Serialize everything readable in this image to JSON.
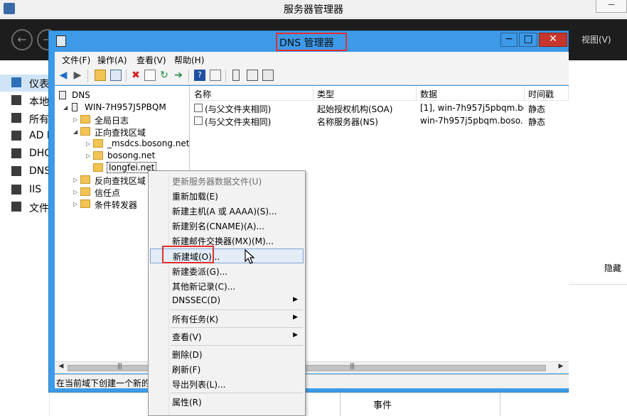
{
  "server_manager": {
    "title": "服务器管理器",
    "view_menu": "视图(V)",
    "sidebar": [
      {
        "label": "仪表",
        "icon": "dashboard-icon"
      },
      {
        "label": "本地",
        "icon": "local-server-icon"
      },
      {
        "label": "所有",
        "icon": "all-servers-icon"
      },
      {
        "label": "AD I",
        "icon": "ad-icon"
      },
      {
        "label": "DHC",
        "icon": "dhcp-icon"
      },
      {
        "label": "DNS",
        "icon": "dns-icon"
      },
      {
        "label": "IIS",
        "icon": "iis-icon"
      },
      {
        "label": "文件",
        "icon": "file-services-icon"
      }
    ],
    "hide_label": "隐藏",
    "events_label": "事件"
  },
  "dns_window": {
    "title": "DNS 管理器",
    "menus": [
      "文件(F)",
      "操作(A)",
      "查看(V)",
      "帮助(H)"
    ],
    "tree": {
      "root": "DNS",
      "server": "WIN-7H957J5PBQM",
      "global_logs": "全局日志",
      "forward_zones": "正向查找区域",
      "msdcs": "_msdcs.bosong.net",
      "bosong": "bosong.net",
      "longfei": "longfei.net",
      "reverse_zones": "反向查找区域",
      "trust_points": "信任点",
      "conditional_forwarders": "条件转发器"
    },
    "columns": [
      "名称",
      "类型",
      "数据",
      "时间戳"
    ],
    "records": [
      {
        "name": "(与父文件夹相同)",
        "type": "起始授权机构(SOA)",
        "data": "[1], win-7h957j5pbqm.bo...",
        "timestamp": "静态"
      },
      {
        "name": "(与父文件夹相同)",
        "type": "名称服务器(NS)",
        "data": "win-7h957j5pbqm.boso...",
        "timestamp": "静态"
      }
    ],
    "status": "在当前域下创建一个新的"
  },
  "context_menu": {
    "items": [
      {
        "label": "更新服务器数据文件(U)",
        "disabled": true
      },
      {
        "label": "重新加载(E)"
      },
      {
        "label": "新建主机(A 或 AAAA)(S)..."
      },
      {
        "label": "新建别名(CNAME)(A)..."
      },
      {
        "label": "新建邮件交换器(MX)(M)..."
      },
      {
        "label": "新建域(O)...",
        "highlighted": true
      },
      {
        "label": "新建委派(G)..."
      },
      {
        "label": "其他新记录(C)..."
      },
      {
        "label": "DNSSEC(D)",
        "submenu": true
      },
      {
        "label": "所有任务(K)",
        "submenu": true
      },
      {
        "label": "查看(V)",
        "submenu": true
      },
      {
        "label": "删除(D)"
      },
      {
        "label": "刷新(F)"
      },
      {
        "label": "导出列表(L)..."
      },
      {
        "label": "属性(R)"
      }
    ]
  }
}
